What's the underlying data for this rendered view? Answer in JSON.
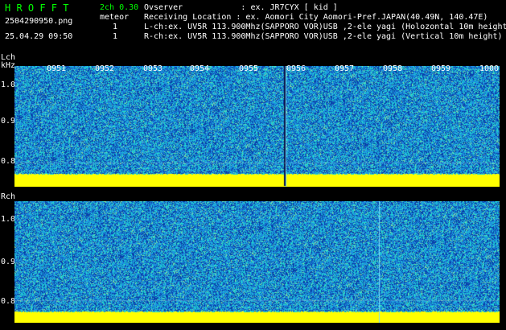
{
  "header": {
    "logo": "H R O F F T",
    "version": "2ch 0.30",
    "filename": "2504290950.png",
    "mode_label": "meteor",
    "count_l": "1",
    "count_r": "1",
    "datetime": "25.04.29 09:50"
  },
  "info": {
    "observer": "Ovserver            : ex. JR7CYX [ kid ]",
    "location": "Receiving Location : ex. Aomori City Aomori-Pref.JAPAN(40.49N, 140.47E)",
    "lch": "L-ch:ex. UV5R 113.900Mhz(SAPPORO VOR)USB ,2-ele yagi (Holozontal 10m height)",
    "rch": "R-ch:ex. UV5R 113.900Mhz(SAPPORO VOR)USB ,2-ele yagi (Vertical 10m height)"
  },
  "lch_panel": {
    "label": "Lch",
    "unit": "kHz",
    "yticks": [
      "1.0",
      "0.9",
      "0.8"
    ],
    "xticks": [
      "0951",
      "0952",
      "0953",
      "0954",
      "0955",
      "0956",
      "0957",
      "0958",
      "0959",
      "1000"
    ]
  },
  "rch_panel": {
    "label": "Rch",
    "yticks": [
      "1.0",
      "0.9",
      "0.8"
    ]
  },
  "colors": {
    "noise_dark": "#0a3fa8",
    "noise_mid": "#1d8fe0",
    "noise_cyan": "#20d8d0",
    "noise_light": "#7fe0a0",
    "carrier": "#ffff00"
  }
}
